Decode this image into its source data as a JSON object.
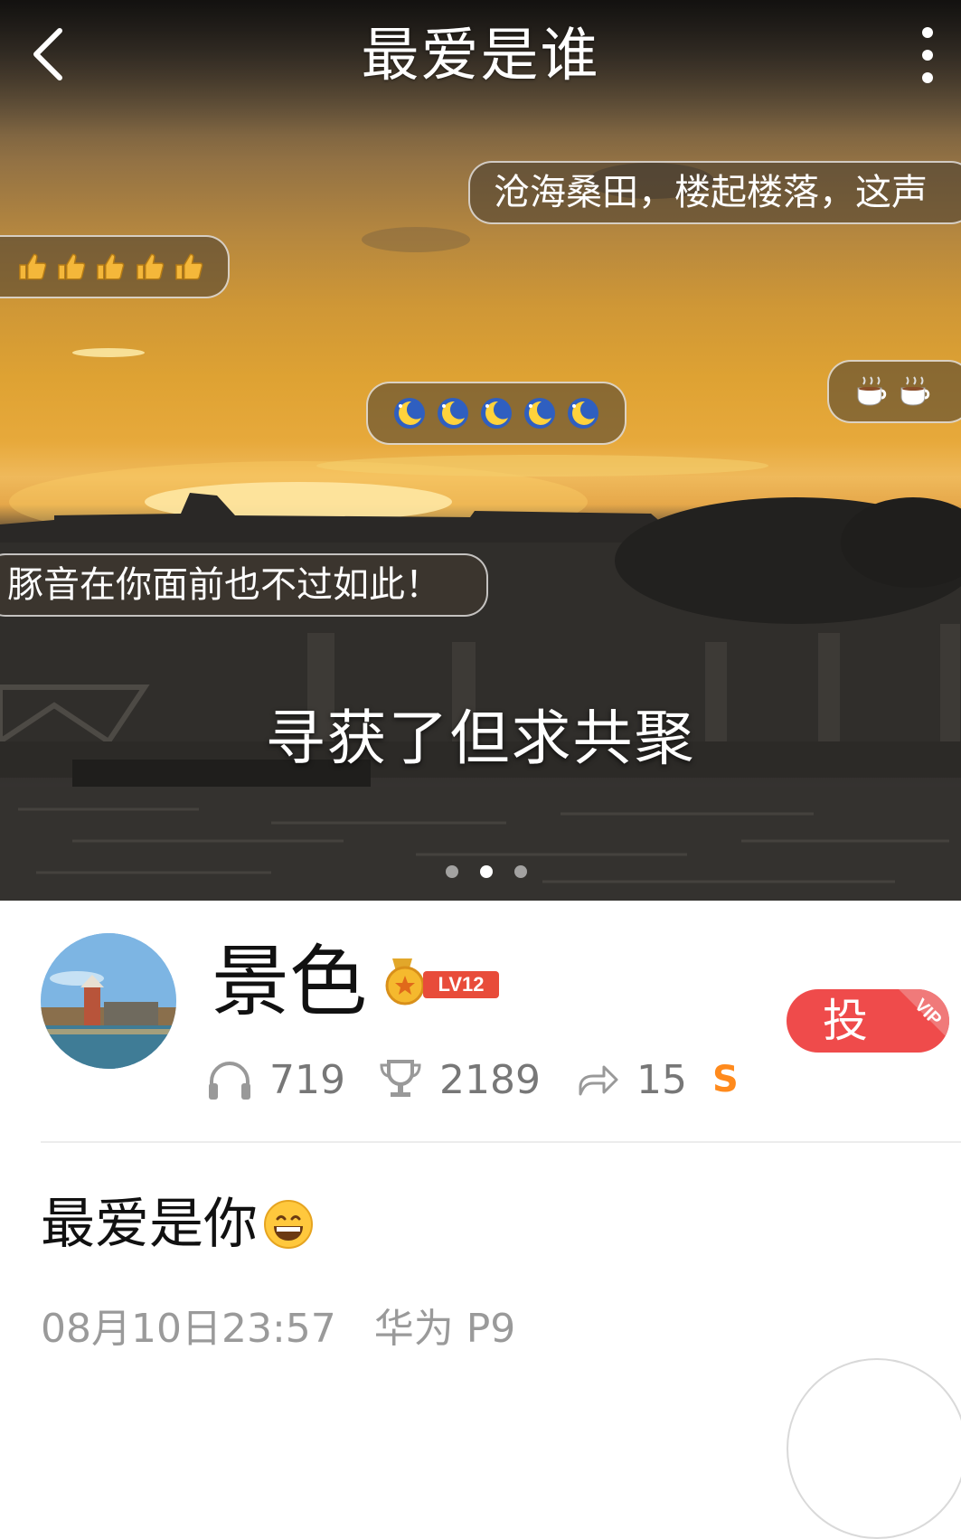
{
  "header": {
    "title": "最爱是谁"
  },
  "danmaku": [
    {
      "text": "沧海桑田，楼起楼落，这声"
    },
    {
      "emoji": "thumbs-up",
      "count": 5
    },
    {
      "emoji": "moon-face",
      "count": 5
    },
    {
      "emoji": "hot-cup",
      "count": 2
    },
    {
      "text": "豚音在你面前也不过如此！"
    }
  ],
  "video": {
    "caption": "寻获了但求共聚",
    "pager": {
      "count": 3,
      "active": 2
    }
  },
  "profile": {
    "name": "景色",
    "level": "LV12",
    "listens": "719",
    "trophies": "2189",
    "shares": "15",
    "badge_s": "S",
    "vote_label": "投",
    "vip_label": "VIP"
  },
  "post": {
    "text": "最爱是你",
    "date": "08月10日23:57",
    "device": "华为 P9"
  },
  "colors": {
    "accent_red": "#ef4b4b",
    "orange_s": "#ff8a1c",
    "meta_gray": "#9a9a9a"
  }
}
